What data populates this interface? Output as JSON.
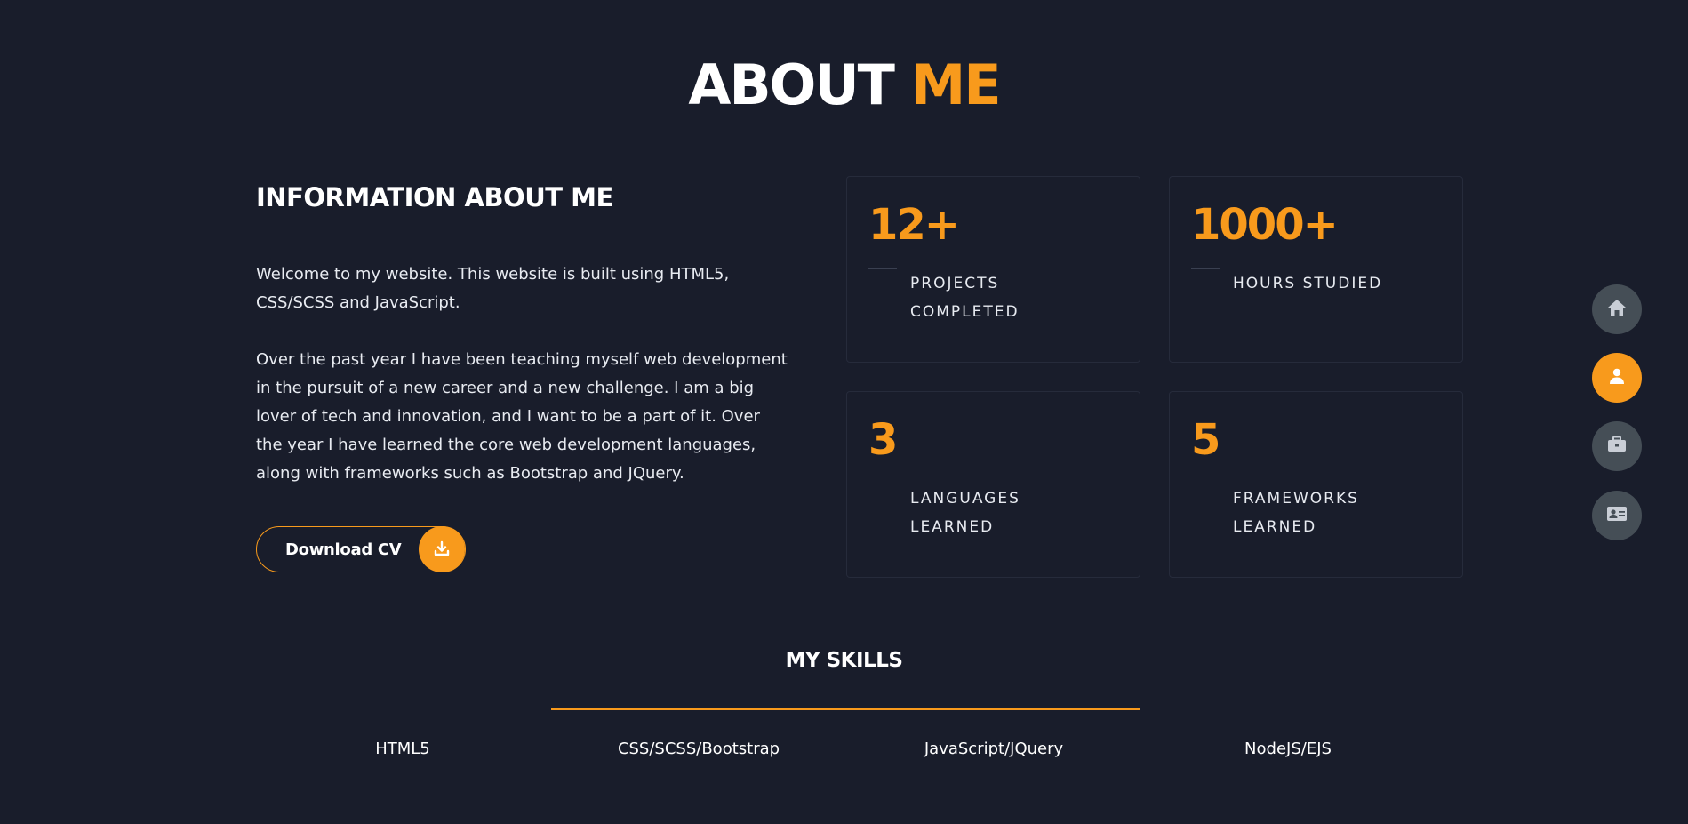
{
  "header": {
    "title_part1": "ABOUT",
    "title_part2": "ME"
  },
  "info": {
    "heading": "INFORMATION ABOUT ME",
    "paragraph1": "Welcome to my website. This website is built using HTML5, CSS/SCSS and JavaScript.",
    "paragraph2": "Over the past year I have been teaching myself web development in the pursuit of a new career and a new challenge. I am a big lover of tech and innovation, and I want to be a part of it. Over the year I have learned the core web development languages, along with frameworks such as Bootstrap and JQuery.",
    "download_label": "Download CV"
  },
  "stats": [
    {
      "value": "12+",
      "label": "PROJECTS COMPLETED"
    },
    {
      "value": "1000+",
      "label": "HOURS STUDIED"
    },
    {
      "value": "3",
      "label": "LANGUAGES LEARNED"
    },
    {
      "value": "5",
      "label": "FRAMEWORKS LEARNED"
    }
  ],
  "skills": {
    "title": "MY SKILLS",
    "items": [
      "HTML5",
      "CSS/SCSS/Bootstrap",
      "JavaScript/JQuery",
      "NodeJS/EJS"
    ]
  },
  "nav": {
    "items": [
      {
        "icon": "home-icon",
        "active": false
      },
      {
        "icon": "user-icon",
        "active": true
      },
      {
        "icon": "briefcase-icon",
        "active": false
      },
      {
        "icon": "contact-card-icon",
        "active": false
      }
    ]
  },
  "colors": {
    "background": "#191d2b",
    "accent": "#f89a1c",
    "nav_inactive": "#454e56",
    "card_border": "#262b3b"
  }
}
